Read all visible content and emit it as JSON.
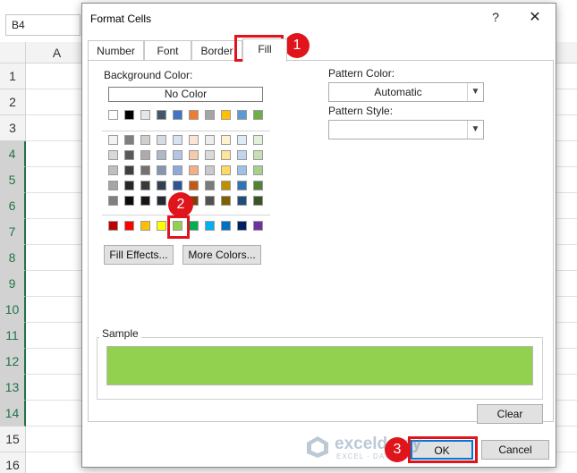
{
  "excel": {
    "name_box": "B4",
    "column_header": "A",
    "rows": [
      "1",
      "2",
      "3",
      "4",
      "5",
      "6",
      "7",
      "8",
      "9",
      "10",
      "11",
      "12",
      "13",
      "14",
      "15",
      "16"
    ],
    "selected_rows": [
      "4",
      "5",
      "6",
      "7",
      "8",
      "9",
      "10",
      "11",
      "12",
      "13",
      "14"
    ]
  },
  "dialog": {
    "title": "Format Cells",
    "help_label": "?",
    "close_label": "✕",
    "tabs": [
      {
        "label": "Number",
        "active": false
      },
      {
        "label": "Font",
        "active": false
      },
      {
        "label": "Border",
        "active": false
      },
      {
        "label": "Fill",
        "active": true
      }
    ],
    "background_color_label": "Background Color:",
    "no_color_label": "No Color",
    "pattern_color_label": "Pattern Color:",
    "pattern_color_value": "Automatic",
    "pattern_style_label": "Pattern Style:",
    "pattern_style_value": "",
    "fill_effects_label": "Fill Effects...",
    "more_colors_label": "More Colors...",
    "sample_label": "Sample",
    "clear_label": "Clear",
    "ok_label": "OK",
    "cancel_label": "Cancel",
    "sample_color": "#92d050",
    "selected_color": "#92d050"
  },
  "palette": {
    "theme_row": [
      "#ffffff",
      "#000000",
      "#e7e6e6",
      "#44546a",
      "#4472c4",
      "#ed7d31",
      "#a5a5a5",
      "#ffc000",
      "#5b9bd5",
      "#70ad47"
    ],
    "tint_rows": [
      [
        "#f2f2f2",
        "#7f7f7f",
        "#d0cece",
        "#d6dce4",
        "#d9e2f3",
        "#fbe4d5",
        "#ededed",
        "#fff2cc",
        "#deeaf6",
        "#e2efd9"
      ],
      [
        "#d8d8d8",
        "#595959",
        "#aeabab",
        "#adb9ca",
        "#b4c6e7",
        "#f7caac",
        "#dbdbdb",
        "#fee599",
        "#bdd6ee",
        "#c5e0b3"
      ],
      [
        "#bfbfbf",
        "#3f3f3f",
        "#757171",
        "#8496b0",
        "#8eaadb",
        "#f4b083",
        "#c9c9c9",
        "#ffd965",
        "#9cc2e5",
        "#a8d08d"
      ],
      [
        "#a5a5a5",
        "#262626",
        "#3a3838",
        "#323f4f",
        "#2f5496",
        "#c45911",
        "#7b7b7b",
        "#bf8f00",
        "#2e75b5",
        "#538135"
      ],
      [
        "#7f7f7f",
        "#0c0c0c",
        "#171616",
        "#222a35",
        "#1f3864",
        "#833c0b",
        "#525252",
        "#7f6000",
        "#1e4e79",
        "#375623"
      ]
    ],
    "standard_row": [
      "#c00000",
      "#ff0000",
      "#ffc000",
      "#ffff00",
      "#92d050",
      "#00b050",
      "#00b0f0",
      "#0070c0",
      "#002060",
      "#7030a0"
    ]
  },
  "annotations": {
    "step1": "1",
    "step2": "2",
    "step3": "3",
    "marker_color": "#e0141b"
  },
  "watermark": {
    "name": "exceldemy",
    "tagline": "EXCEL · DATA · BI"
  }
}
